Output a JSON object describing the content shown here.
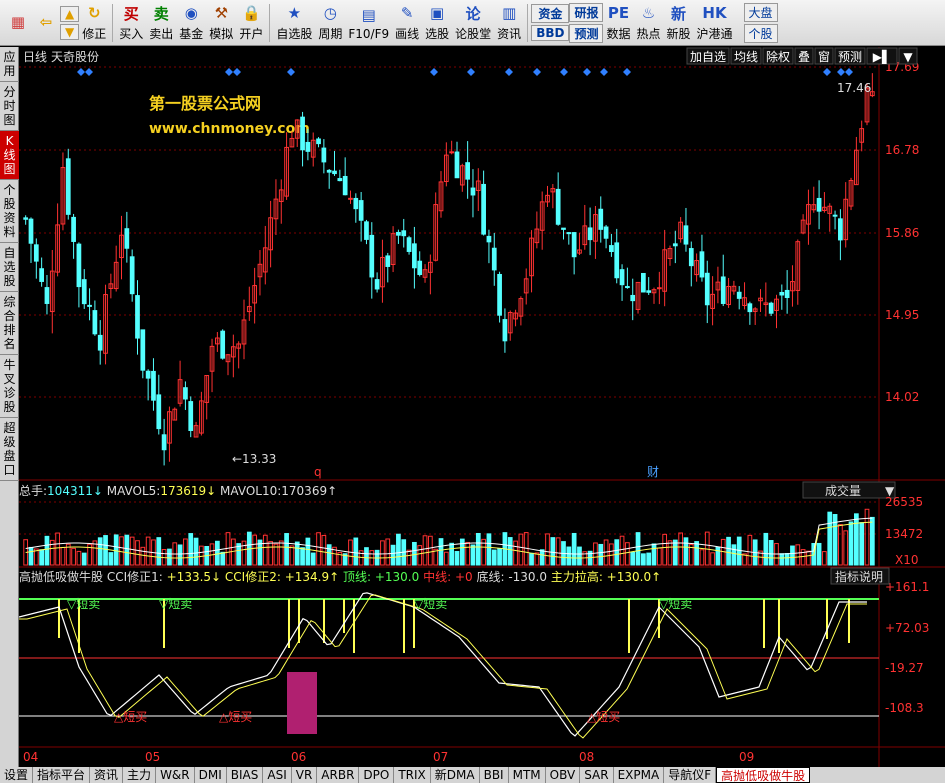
{
  "toolbar": {
    "buttons": [
      {
        "name": "home-button",
        "label": "",
        "icon": "home-grid-icon",
        "color": "#d04040"
      },
      {
        "name": "back-button",
        "label": "",
        "icon": "back-arrow-icon",
        "color": "#e0a000"
      },
      {
        "name": "sync-button",
        "label": "修正",
        "icon": "sync-icon",
        "color": "#e0a000"
      },
      {
        "name": "buy-button",
        "label": "买入",
        "icon": "buy-icon",
        "color": "#c00000"
      },
      {
        "name": "sell-button",
        "label": "卖出",
        "icon": "sell-icon",
        "color": "#008000"
      },
      {
        "name": "fund-button",
        "label": "基金",
        "icon": "fund-icon",
        "color": "#2050c0"
      },
      {
        "name": "simulate-button",
        "label": "模拟",
        "icon": "hammer-icon",
        "color": "#a04000"
      },
      {
        "name": "open-account-button",
        "label": "开户",
        "icon": "lock-icon",
        "color": "#806000"
      },
      {
        "name": "watchlist-button",
        "label": "自选股",
        "icon": "star-icon",
        "color": "#2050c0"
      },
      {
        "name": "period-button",
        "label": "周期",
        "icon": "clock-icon",
        "color": "#2050c0"
      },
      {
        "name": "f10-button",
        "label": "F10/F9",
        "icon": "document-icon",
        "color": "#2050c0"
      },
      {
        "name": "draw-button",
        "label": "画线",
        "icon": "pencil-icon",
        "color": "#2050c0"
      },
      {
        "name": "pick-button",
        "label": "选股",
        "icon": "screen-icon",
        "color": "#2050c0"
      },
      {
        "name": "forum-button",
        "label": "论股堂",
        "icon": "forum-icon",
        "color": "#2050c0"
      },
      {
        "name": "news-button",
        "label": "资讯",
        "icon": "news-icon",
        "color": "#2050c0"
      }
    ],
    "up_label": "▲",
    "down_label": "▼",
    "funds_label": "资金",
    "bbd_label": "BBD",
    "research_label": "研报",
    "forecast_label": "预测",
    "right_buttons": [
      {
        "name": "data-button",
        "label": "数据",
        "icon": "pe-icon"
      },
      {
        "name": "hot-button",
        "label": "热点",
        "icon": "fire-icon"
      },
      {
        "name": "new-stock-button",
        "label": "新股",
        "icon": "newstock-icon"
      },
      {
        "name": "hk-connect-button",
        "label": "沪港通",
        "icon": "hk-icon"
      }
    ],
    "market_label": "大盘",
    "stock_label": "个股"
  },
  "leftnav": [
    {
      "label": "应用",
      "active": false
    },
    {
      "label": "分时图",
      "active": false
    },
    {
      "label": "K线图",
      "active": true
    },
    {
      "label": "个股资料",
      "active": false
    },
    {
      "label": "自选股",
      "active": false
    },
    {
      "label": "综合排名",
      "active": false
    },
    {
      "label": "牛叉诊股",
      "active": false
    },
    {
      "label": "超级盘口",
      "active": false
    }
  ],
  "main_chart": {
    "period_label": "日线",
    "stock_name": "天奇股份",
    "watermark_title": "第一股票公式网",
    "watermark_url": "www.chnmoney.com",
    "top_buttons": [
      "加自选",
      "均线",
      "除权",
      "叠",
      "窗",
      "预测",
      "▶▌",
      "▼"
    ],
    "price_axis": [
      "17.69",
      "16.78",
      "15.86",
      "14.95",
      "14.02"
    ],
    "high_label": "17.46",
    "low_label": "←13.33",
    "event_q": "q",
    "event_cai": "财",
    "colors": {
      "up": "#ff3232",
      "down": "#54ffff",
      "grid": "#800000",
      "axis_text": "#ff3232",
      "diamond": "#3080ff"
    }
  },
  "volume_panel": {
    "total_label": "总手:",
    "total_value": "104311",
    "ma5_label": "MAVOL5:",
    "ma5_value": "173619",
    "ma10_label": "MAVOL10:",
    "ma10_value": "170369",
    "dropdown_label": "成交量",
    "axis": [
      "26535",
      "13472"
    ],
    "unit": "X10"
  },
  "indicator_panel": {
    "name": "高抛低吸做牛股",
    "cci1_label": "CCI修正1:",
    "cci1_value": "+133.5",
    "cci2_label": "CCI修正2:",
    "cci2_value": "+134.9",
    "top_label": "顶线:",
    "top_value": "+130.0",
    "mid_label": "中线:",
    "mid_value": "+0",
    "bottom_label": "底线:",
    "bottom_value": "-130.0",
    "main_label": "主力拉高:",
    "main_value": "+130.0",
    "help_button": "指标说明",
    "axis": [
      "+161.1",
      "+72.03",
      "-19.27",
      "-108.3"
    ],
    "sell_label": "▽短卖",
    "buy_label": "△短买"
  },
  "months": [
    "04",
    "05",
    "06",
    "07",
    "08",
    "09"
  ],
  "bottom_tabs": [
    "设置",
    "指标平台",
    "资讯",
    "主力",
    "W&R",
    "DMI",
    "BIAS",
    "ASI",
    "VR",
    "ARBR",
    "DPO",
    "TRIX",
    "新DMA",
    "BBI",
    "MTM",
    "OBV",
    "SAR",
    "EXPMA",
    "导航仪F",
    "高抛低吸做牛股"
  ],
  "active_tab": "高抛低吸做牛股"
}
